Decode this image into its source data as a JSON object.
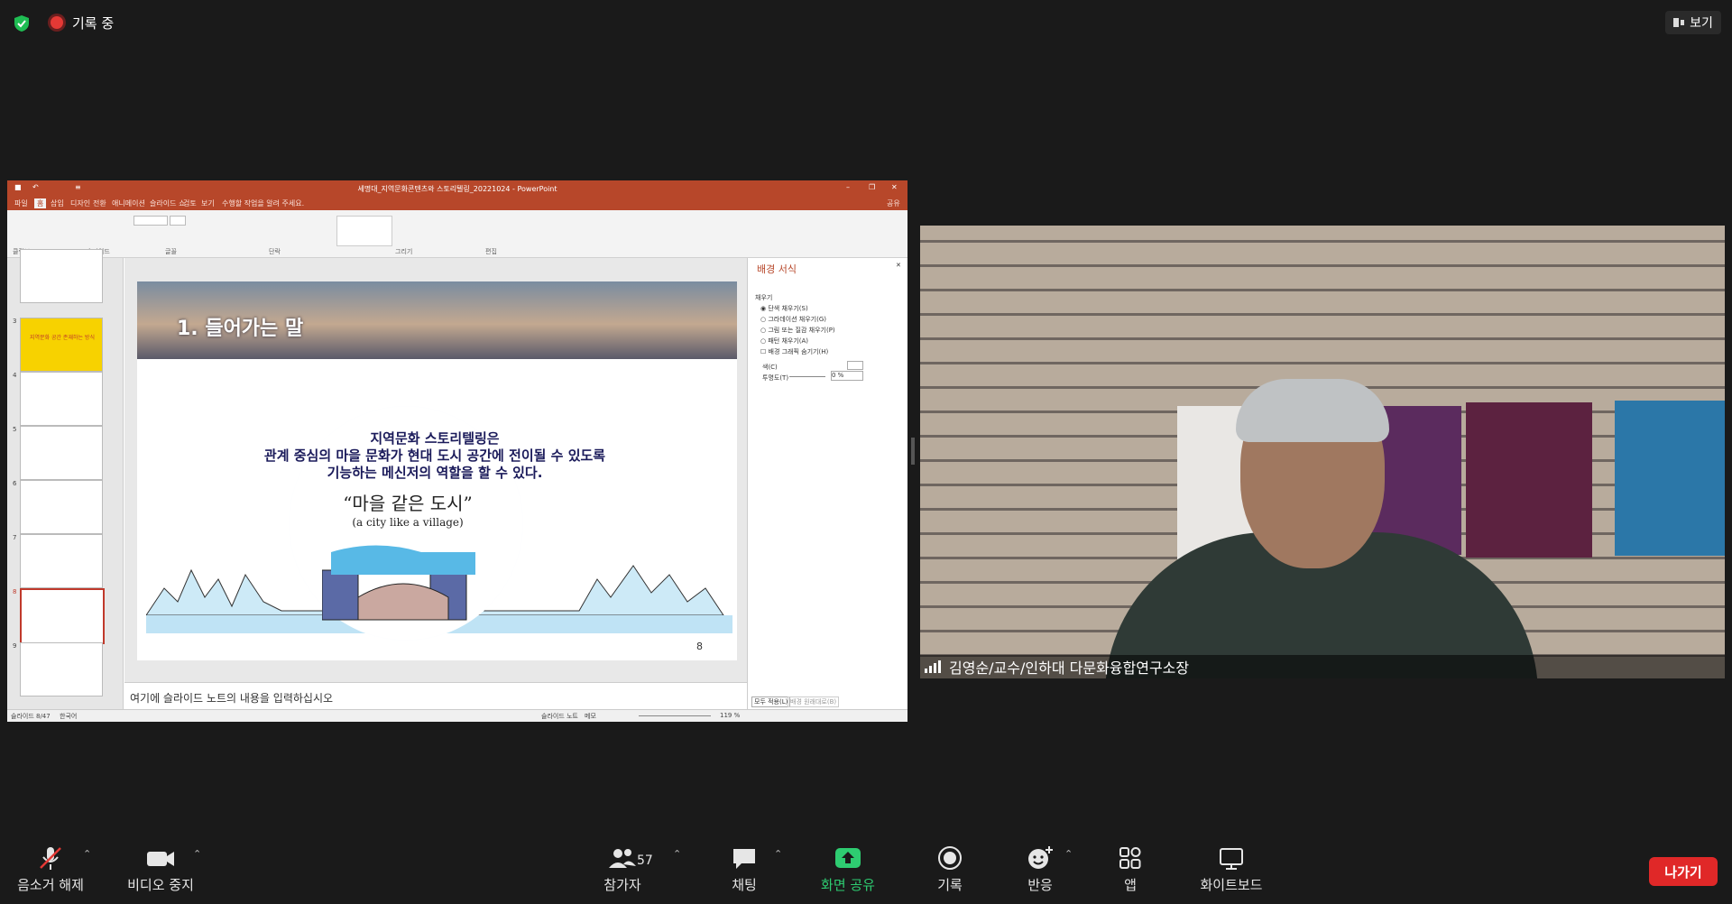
{
  "top_bar": {
    "recording_label": "기록 중",
    "view_label": "보기"
  },
  "shared_screen": {
    "window_title": "세명대_지역문화콘텐츠와 스토리텔링_20221024 - PowerPoint",
    "menu_tabs": [
      "파일",
      "홈",
      "삽입",
      "디자인",
      "전환",
      "애니메이션",
      "슬라이드 쇼",
      "검토",
      "보기",
      "수행할 작업을 알려 주세요."
    ],
    "share_label": "공유",
    "ribbon_groups": [
      "클립보드",
      "슬라이드",
      "글꼴",
      "단락",
      "그리기",
      "편집"
    ],
    "thumbnail_numbers": [
      "3",
      "4",
      "5",
      "6",
      "7",
      "8",
      "9"
    ],
    "thumbnail_3_text": "지역문화 공간 존재하는 방식",
    "slide": {
      "heading": "1. 들어가는 말",
      "body_line1": "지역문화 스토리텔링은",
      "body_line2": "관계 중심의 마을 문화가 현대 도시 공간에 전이될 수 있도록",
      "body_line3": "기능하는 메신저의 역할을 할 수 있다.",
      "quote": "“마을 같은 도시”",
      "quote_en": "(a city like a village)",
      "page_number": "8"
    },
    "notes_placeholder": "여기에 슬라이드 노트의 내용을 입력하십시오",
    "format_pane": {
      "title": "배경 서식",
      "section": "채우기",
      "options": [
        "단색 채우기(S)",
        "그라데이션 채우기(G)",
        "그림 또는 질감 채우기(P)",
        "패턴 채우기(A)",
        "배경 그래픽 숨기기(H)"
      ],
      "color_label": "색(C)",
      "transparency_label": "투명도(T)",
      "transparency_value": "0 %",
      "apply_all": "모두 적용(L)",
      "reset": "배경 원래대로(B)"
    },
    "status": {
      "slide_counter": "슬라이드 8/47",
      "language": "한국어",
      "notes": "슬라이드 노트",
      "comments": "메모",
      "zoom": "119 %"
    }
  },
  "video": {
    "participant_name": "김영순/교수/인하대 다문화융합연구소장"
  },
  "toolbar": {
    "unmute_label": "음소거 해제",
    "stop_video_label": "비디오 중지",
    "participants_label": "참가자",
    "participants_count": "57",
    "chat_label": "채팅",
    "share_label": "화면 공유",
    "record_label": "기록",
    "reactions_label": "반응",
    "apps_label": "앱",
    "whiteboard_label": "화이트보드",
    "leave_label": "나가기"
  },
  "colors": {
    "background": "#1a1a1a",
    "share_active": "#2ecc71",
    "leave": "#e02828",
    "powerpoint": "#b7472a"
  }
}
